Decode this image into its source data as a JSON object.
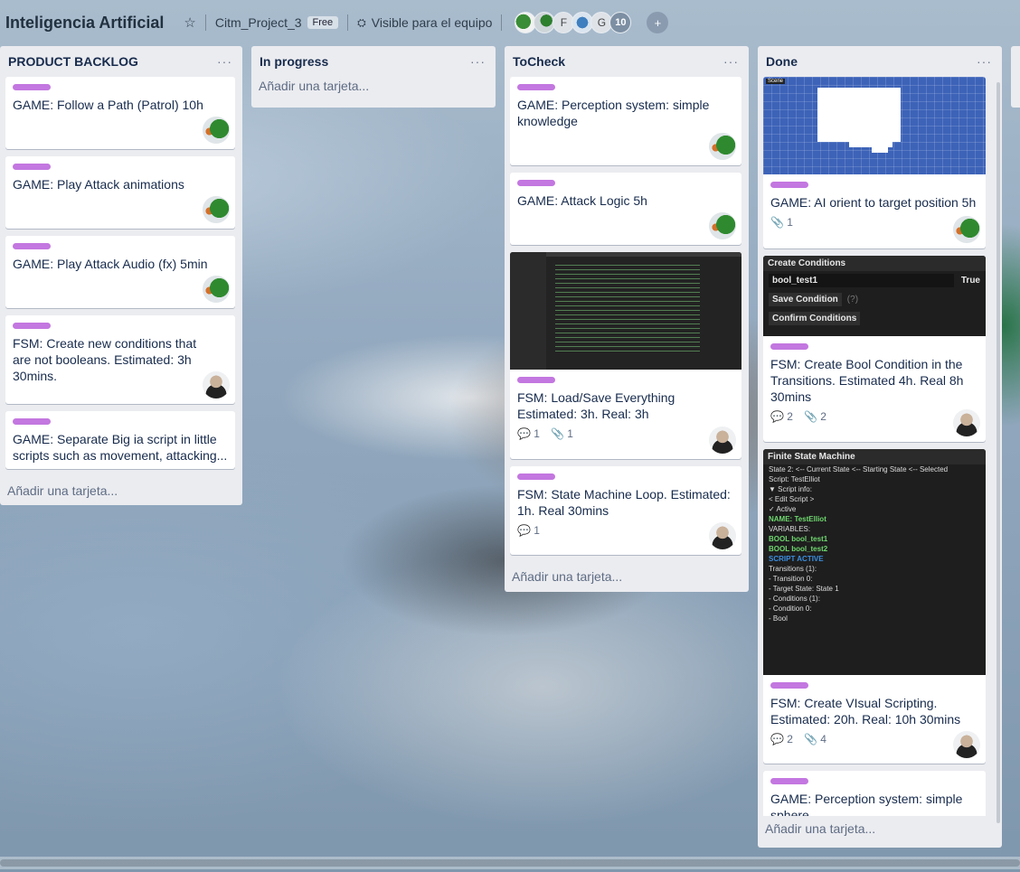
{
  "header": {
    "board_title": "Inteligencia Artificial",
    "team_name": "Citm_Project_3",
    "plan_badge": "Free",
    "visibility": "Visible para el equipo",
    "members": [
      "green-avatar",
      "duck-avatar",
      "F",
      "blue-avatar",
      "G"
    ],
    "member_letters": {
      "f": "F",
      "g": "G"
    },
    "member_count": "10"
  },
  "lists": {
    "backlog": {
      "title": "PRODUCT BACKLOG",
      "menu": "···",
      "cards": [
        {
          "title": "GAME: Follow a Path (Patrol) 10h",
          "avatar": "duck"
        },
        {
          "title": "GAME: Play Attack animations",
          "avatar": "duck"
        },
        {
          "title": "GAME: Play Attack Audio (fx) 5min",
          "avatar": "duck"
        },
        {
          "title": "FSM: Create new conditions that are not booleans. Estimated: 3h 30mins.",
          "avatar": "man"
        },
        {
          "title": "GAME: Separate Big ia script in little scripts such as movement, attacking...",
          "avatar": ""
        }
      ],
      "add_card": "Añadir una tarjeta..."
    },
    "inprogress": {
      "title": "In progress",
      "menu": "···",
      "add_card": "Añadir una tarjeta..."
    },
    "tocheck": {
      "title": "ToCheck",
      "menu": "···",
      "cards": [
        {
          "title": "GAME: Perception system: simple knowledge",
          "avatar": "duck"
        },
        {
          "title": "GAME: Attack Logic 5h",
          "avatar": "duck"
        },
        {
          "title": "FSM: Load/Save Everything Estimated: 3h. Real: 3h",
          "comments": "1",
          "attachments": "1",
          "avatar": "man"
        },
        {
          "title": "FSM: State Machine Loop. Estimated: 1h. Real 30mins",
          "comments": "1",
          "avatar": "man"
        }
      ],
      "add_card": "Añadir una tarjeta..."
    },
    "done": {
      "title": "Done",
      "menu": "···",
      "cards": [
        {
          "title": "GAME: AI orient to target position 5h",
          "attachments": "1",
          "avatar": "duck",
          "cover_tag": "Scene"
        },
        {
          "title": "FSM: Create Bool Condition in the Transitions. Estimated 4h. Real 8h 30mins",
          "comments": "2",
          "attachments": "2",
          "avatar": "man"
        },
        {
          "title": "FSM: Create VIsual Scripting. Estimated: 20h. Real: 10h 30mins",
          "comments": "2",
          "attachments": "4",
          "avatar": "man"
        },
        {
          "title": "GAME: Perception system: simple sphere",
          "avatar": ""
        }
      ],
      "cover_conditions": {
        "header": "Create Conditions",
        "field": "bool_test1",
        "checkbox_label": "True",
        "save": "Save Condition",
        "save_hint": "(?)",
        "confirm": "Confirm Conditions"
      },
      "cover_fsm": {
        "header": "Finite State Machine",
        "lines": [
          "State 2:   <-- Current State   <-- Starting State   <-- Selected",
          "Script: TestElliot",
          "  ▼ Script info:",
          "      < Edit Script >",
          "      ✓  Active",
          "      NAME:  TestElliot",
          "      VARIABLES:",
          "      BOOL   bool_test1",
          "      BOOL   bool_test2",
          "      SCRIPT ACTIVE",
          "Transitions (1):",
          "  - Transition 0:",
          "  - Target State: State 1",
          "    - Conditions (1):",
          "      - Condition 0:",
          "        - Bool"
        ]
      },
      "add_card": "Añadir una tarjeta..."
    }
  },
  "colors": {
    "label_purple": "#c377e0",
    "list_bg": "#ebecf0",
    "title_text": "#172b4d"
  }
}
